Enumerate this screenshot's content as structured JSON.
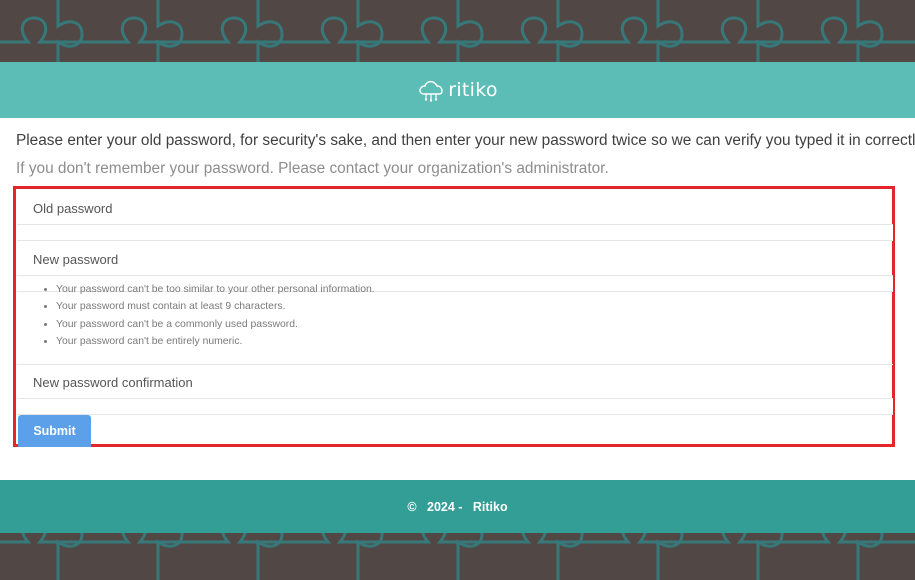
{
  "brand": {
    "name": "ritiko",
    "logo_icon": "cloud-network-icon"
  },
  "intro": {
    "text": "Please enter your old password, for security's sake, and then enter your new password twice so we can verify you typed it in correctly."
  },
  "hint": {
    "text": "If you don't remember your password. Please contact your organization's administrator."
  },
  "form": {
    "old_password_label": "Old password",
    "old_password_value": "",
    "new_password_label": "New password",
    "new_password_value": "",
    "rules": [
      "Your password can't be too similar to your other personal information.",
      "Your password must contain at least 9 characters.",
      "Your password can't be a commonly used password.",
      "Your password can't be entirely numeric."
    ],
    "confirm_label": "New password confirmation",
    "confirm_value": "",
    "submit_label": "Submit"
  },
  "footer": {
    "copyright": "©",
    "year": "2024 -",
    "company": "Ritiko"
  },
  "colors": {
    "background": "#514744",
    "puzzle_lines": "#37787a",
    "brand_bar": "#5bbdb5",
    "footer": "#329e96",
    "submit_button": "#5ba0e8",
    "highlight_border": "#e3262b"
  }
}
